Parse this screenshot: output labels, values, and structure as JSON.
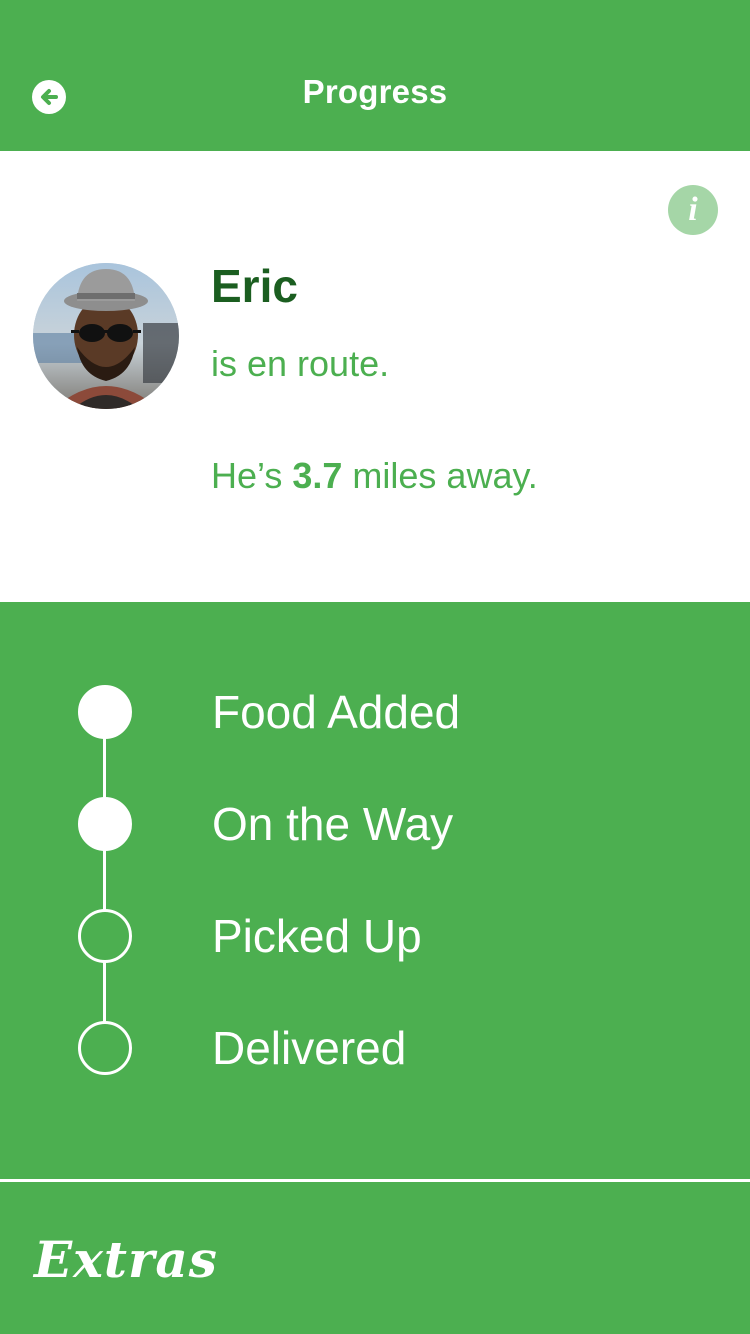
{
  "header": {
    "title": "Progress",
    "back_icon": "arrow-left-circle-icon"
  },
  "driver": {
    "name": "Eric",
    "status": "is en route.",
    "distance_prefix": "He’s ",
    "distance_value": "3.7",
    "distance_suffix": " miles away.",
    "info_label": "i",
    "info_icon": "info-icon"
  },
  "timeline": {
    "steps": [
      {
        "label": "Food Added",
        "done": true
      },
      {
        "label": "On the Way",
        "done": true
      },
      {
        "label": "Picked Up",
        "done": false
      },
      {
        "label": "Delivered",
        "done": false
      }
    ]
  },
  "footer": {
    "extras_label": "Extras"
  },
  "colors": {
    "brand_green": "#4caf50",
    "dark_green": "#1b5e20",
    "light_green": "#a5d6a7",
    "white": "#ffffff"
  }
}
